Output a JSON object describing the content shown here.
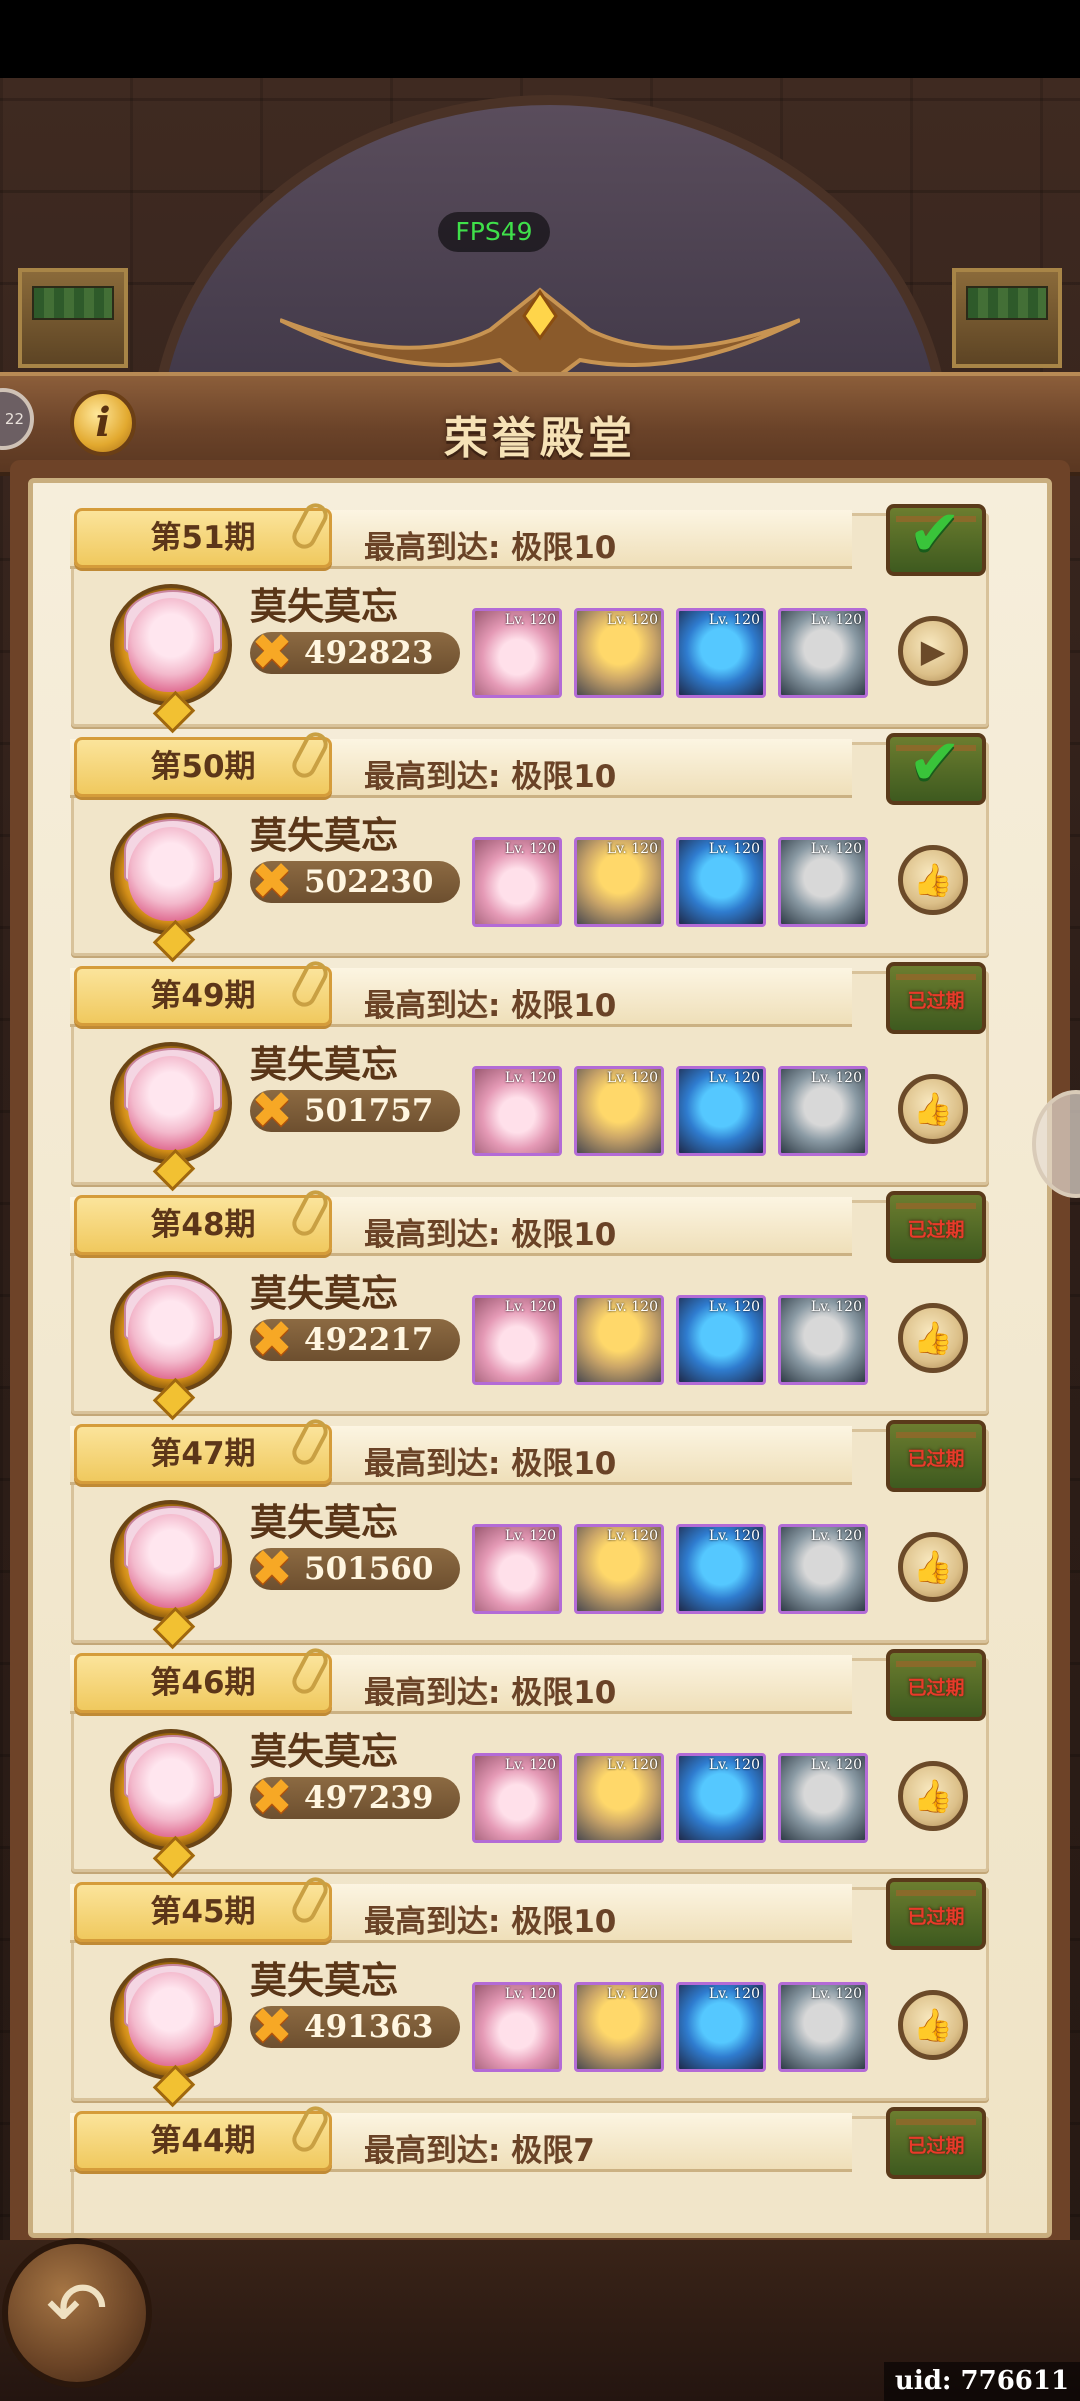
{
  "fps": "FPS49",
  "left_peek_text": "22",
  "header": {
    "title": "荣誉殿堂",
    "info_label": "i"
  },
  "seasons": [
    {
      "period": "第51期",
      "best": "最高到达: 极限10",
      "player": "莫失莫忘",
      "power": "492823",
      "chest": "claimed",
      "action": "play-icon",
      "heroes": [
        "Lv. 120",
        "Lv. 120",
        "Lv. 120",
        "Lv. 120"
      ]
    },
    {
      "period": "第50期",
      "best": "最高到达: 极限10",
      "player": "莫失莫忘",
      "power": "502230",
      "chest": "claimed",
      "action": "thumbs-up-icon-liked",
      "heroes": [
        "Lv. 120",
        "Lv. 120",
        "Lv. 120",
        "Lv. 120"
      ]
    },
    {
      "period": "第49期",
      "best": "最高到达: 极限10",
      "player": "莫失莫忘",
      "power": "501757",
      "chest": "已过期",
      "action": "thumbs-up-icon",
      "heroes": [
        "Lv. 120",
        "Lv. 120",
        "Lv. 120",
        "Lv. 120"
      ]
    },
    {
      "period": "第48期",
      "best": "最高到达: 极限10",
      "player": "莫失莫忘",
      "power": "492217",
      "chest": "已过期",
      "action": "thumbs-up-icon",
      "heroes": [
        "Lv. 120",
        "Lv. 120",
        "Lv. 120",
        "Lv. 120"
      ]
    },
    {
      "period": "第47期",
      "best": "最高到达: 极限10",
      "player": "莫失莫忘",
      "power": "501560",
      "chest": "已过期",
      "action": "thumbs-up-icon",
      "heroes": [
        "Lv. 120",
        "Lv. 120",
        "Lv. 120",
        "Lv. 120"
      ]
    },
    {
      "period": "第46期",
      "best": "最高到达: 极限10",
      "player": "莫失莫忘",
      "power": "497239",
      "chest": "已过期",
      "action": "thumbs-up-icon",
      "heroes": [
        "Lv. 120",
        "Lv. 120",
        "Lv. 120",
        "Lv. 120"
      ]
    },
    {
      "period": "第45期",
      "best": "最高到达: 极限10",
      "player": "莫失莫忘",
      "power": "491363",
      "chest": "已过期",
      "action": "thumbs-up-icon",
      "heroes": [
        "Lv. 120",
        "Lv. 120",
        "Lv. 120",
        "Lv. 120"
      ]
    },
    {
      "period": "第44期",
      "best": "最高到达: 极限7",
      "player": "",
      "power": "",
      "chest": "已过期",
      "action": "",
      "heroes": []
    }
  ],
  "uid": "uid: 776611",
  "colors": {
    "accent_gold": "#f0c95e",
    "panel_brown": "#6e4328",
    "parchment": "#f1e5c9",
    "check_green": "#39c43a",
    "expired_red": "#e83a2a"
  }
}
